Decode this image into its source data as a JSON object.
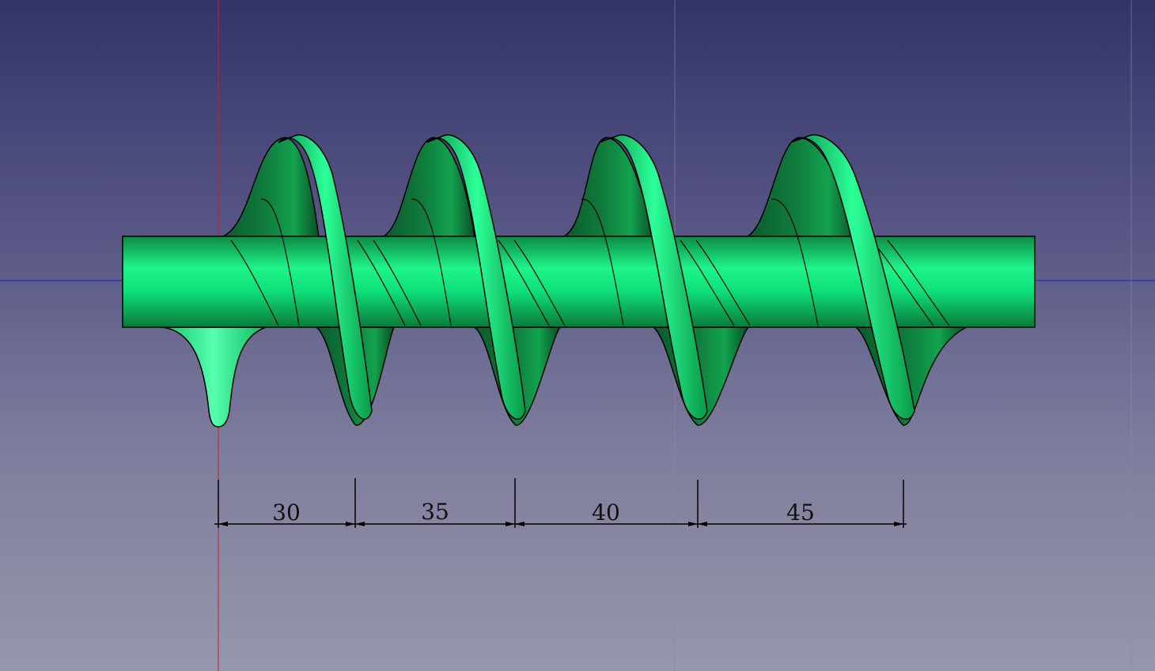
{
  "viewport": {
    "background_top": "#33336a",
    "background_bottom": "#9697ad",
    "model_color": "#00e070",
    "vertical_axis_color": "#c81e2a",
    "horizontal_axis_color": "#1a1ad0"
  },
  "dimensions": [
    {
      "label": "30"
    },
    {
      "label": "35"
    },
    {
      "label": "40"
    },
    {
      "label": "45"
    }
  ]
}
